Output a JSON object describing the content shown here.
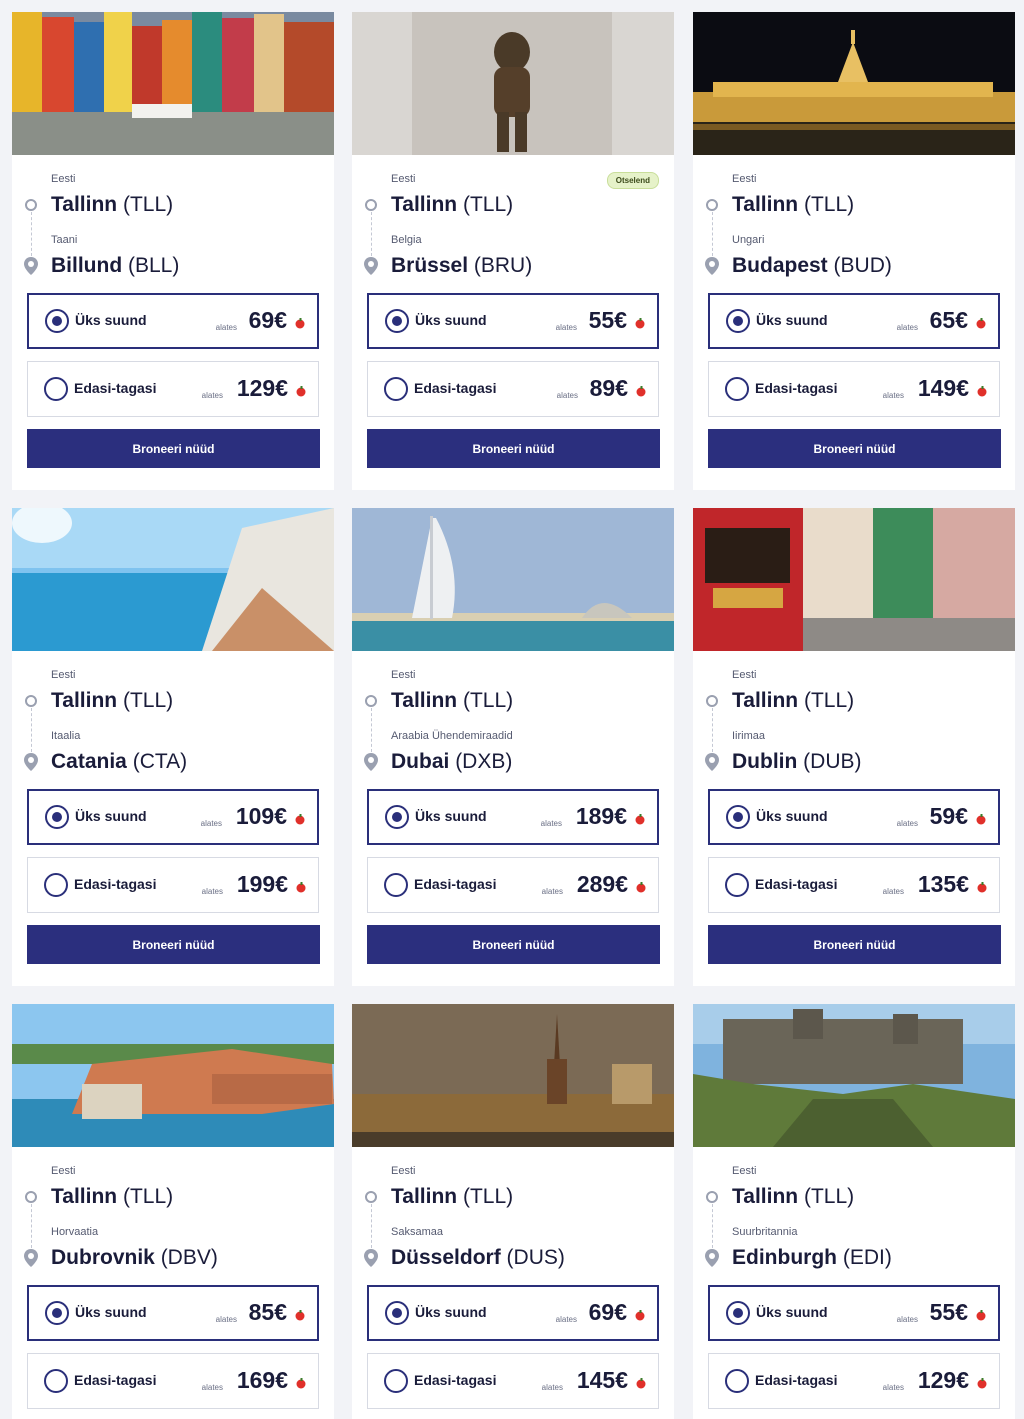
{
  "colors": {
    "brand": "#2b2f7e",
    "page_bg": "#f2f3f7",
    "badge_bg": "#e6f2c9"
  },
  "labels": {
    "one_way": "Üks suund",
    "round_trip": "Edasi-tagasi",
    "from": "alates",
    "book": "Broneeri nüüd"
  },
  "cards": [
    {
      "origin_country": "Eesti",
      "origin_city": "Tallinn",
      "origin_code": "(TLL)",
      "dest_country": "Taani",
      "dest_city": "Billund",
      "dest_code": "(BLL)",
      "one_way_price": "69€",
      "round_trip_price": "129€",
      "badge": "",
      "image": "colorful-harbor-houses"
    },
    {
      "origin_country": "Eesti",
      "origin_city": "Tallinn",
      "origin_code": "(TLL)",
      "dest_country": "Belgia",
      "dest_city": "Brüssel",
      "dest_code": "(BRU)",
      "one_way_price": "55€",
      "round_trip_price": "89€",
      "badge": "Otselend",
      "image": "bronze-statue"
    },
    {
      "origin_country": "Eesti",
      "origin_city": "Tallinn",
      "origin_code": "(TLL)",
      "dest_country": "Ungari",
      "dest_city": "Budapest",
      "dest_code": "(BUD)",
      "one_way_price": "65€",
      "round_trip_price": "149€",
      "badge": "",
      "image": "parliament-at-night"
    },
    {
      "origin_country": "Eesti",
      "origin_city": "Tallinn",
      "origin_code": "(TLL)",
      "dest_country": "Itaalia",
      "dest_city": "Catania",
      "dest_code": "(CTA)",
      "one_way_price": "109€",
      "round_trip_price": "199€",
      "badge": "",
      "image": "sea-cliffs"
    },
    {
      "origin_country": "Eesti",
      "origin_city": "Tallinn",
      "origin_code": "(TLL)",
      "dest_country": "Araabia Ühendemiraadid",
      "dest_city": "Dubai",
      "dest_code": "(DXB)",
      "one_way_price": "189€",
      "round_trip_price": "289€",
      "badge": "",
      "image": "sail-hotel"
    },
    {
      "origin_country": "Eesti",
      "origin_city": "Tallinn",
      "origin_code": "(TLL)",
      "dest_country": "Iirimaa",
      "dest_city": "Dublin",
      "dest_code": "(DUB)",
      "one_way_price": "59€",
      "round_trip_price": "135€",
      "badge": "",
      "image": "red-pub-street"
    },
    {
      "origin_country": "Eesti",
      "origin_city": "Tallinn",
      "origin_code": "(TLL)",
      "dest_country": "Horvaatia",
      "dest_city": "Dubrovnik",
      "dest_code": "(DBV)",
      "one_way_price": "85€",
      "round_trip_price": "169€",
      "badge": "",
      "image": "walled-old-town"
    },
    {
      "origin_country": "Eesti",
      "origin_city": "Tallinn",
      "origin_code": "(TLL)",
      "dest_country": "Saksamaa",
      "dest_city": "Düsseldorf",
      "dest_code": "(DUS)",
      "one_way_price": "69€",
      "round_trip_price": "145€",
      "badge": "",
      "image": "church-spire-riverside"
    },
    {
      "origin_country": "Eesti",
      "origin_city": "Tallinn",
      "origin_code": "(TLL)",
      "dest_country": "Suurbritannia",
      "dest_city": "Edinburgh",
      "dest_code": "(EDI)",
      "one_way_price": "55€",
      "round_trip_price": "129€",
      "badge": "",
      "image": "castle-on-rock"
    }
  ]
}
